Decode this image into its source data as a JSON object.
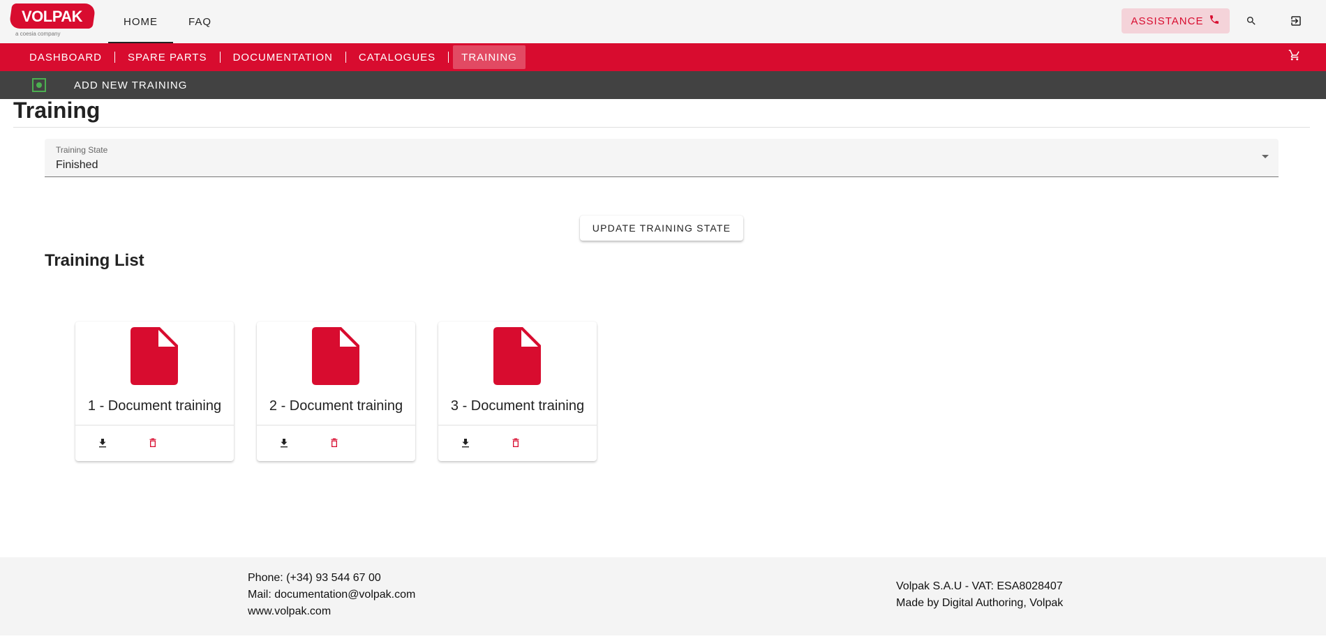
{
  "logo": {
    "brand": "VOLPAK",
    "sub": "a coesia company"
  },
  "topnav": {
    "items": [
      "HOME",
      "FAQ"
    ]
  },
  "assistance": {
    "label": "ASSISTANCE"
  },
  "icons": {
    "phone": "phone-icon",
    "search": "search-icon",
    "logout": "logout-icon",
    "cart": "cart-icon",
    "add": "add-box-icon",
    "document": "document-icon",
    "download": "download-icon",
    "delete": "delete-icon"
  },
  "rednav": {
    "items": [
      "DASHBOARD",
      "SPARE PARTS",
      "DOCUMENTATION",
      "CATALOGUES",
      "TRAINING"
    ],
    "active": "TRAINING"
  },
  "toolbar": {
    "add_label": "ADD NEW TRAINING"
  },
  "page": {
    "title": "Training"
  },
  "filter": {
    "label": "Training State",
    "value": "Finished"
  },
  "update_button": "UPDATE TRAINING STATE",
  "list": {
    "title": "Training List",
    "cards": [
      {
        "name": "1 - Document training"
      },
      {
        "name": "2 - Document training"
      },
      {
        "name": "3 - Document training"
      }
    ]
  },
  "footer": {
    "phone": "Phone: (+34) 93 544 67 00",
    "mail": "Mail: documentation@volpak.com",
    "web": "www.volpak.com",
    "company": "Volpak S.A.U - VAT: ESA8028407",
    "made_by": "Made by Digital Authoring, Volpak"
  },
  "colors": {
    "brand": "#d80c2f",
    "dark": "#424242",
    "accent_green": "#4caf50"
  }
}
